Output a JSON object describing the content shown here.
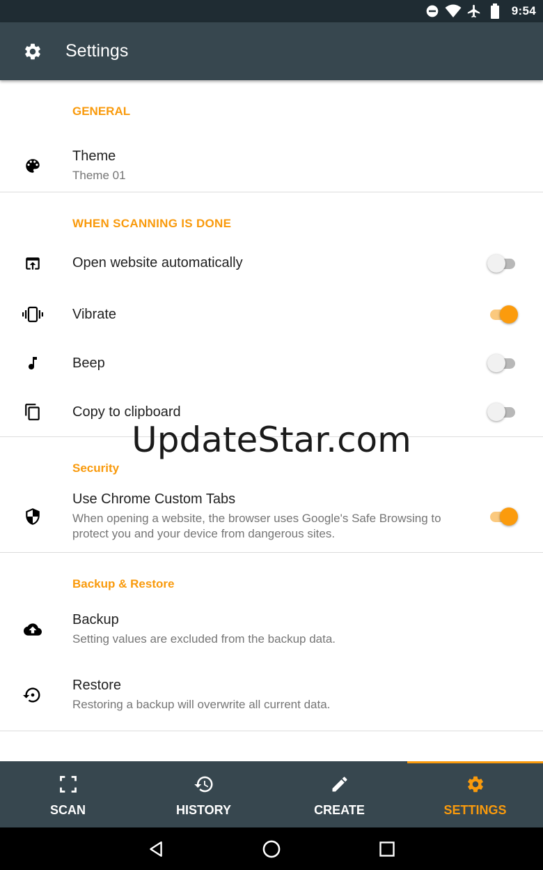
{
  "status_bar": {
    "time": "9:54",
    "icons": [
      "do-not-disturb-icon",
      "wifi-icon",
      "airplane-icon",
      "battery-icon"
    ]
  },
  "app_bar": {
    "title": "Settings",
    "icon": "gear-icon"
  },
  "sections": {
    "general": {
      "header": "GENERAL",
      "theme": {
        "title": "Theme",
        "subtitle": "Theme 01",
        "icon": "palette-icon"
      }
    },
    "scanning": {
      "header": "WHEN SCANNING IS DONE",
      "open_website": {
        "title": "Open website automatically",
        "enabled": false,
        "icon": "open-in-browser-icon"
      },
      "vibrate": {
        "title": "Vibrate",
        "enabled": true,
        "icon": "vibrate-icon"
      },
      "beep": {
        "title": "Beep",
        "enabled": false,
        "icon": "music-note-icon"
      },
      "copy_clipboard": {
        "title": "Copy to clipboard",
        "enabled": false,
        "icon": "copy-icon"
      }
    },
    "security": {
      "header": "Security",
      "chrome_tabs": {
        "title": "Use Chrome Custom Tabs",
        "subtitle": "When opening a website, the browser uses Google's Safe Browsing to protect you and your device from dangerous sites.",
        "enabled": true,
        "icon": "shield-icon"
      }
    },
    "backup": {
      "header": "Backup & Restore",
      "backup": {
        "title": "Backup",
        "subtitle": "Setting values are excluded from the backup data.",
        "icon": "cloud-upload-icon"
      },
      "restore": {
        "title": "Restore",
        "subtitle": "Restoring a backup will overwrite all current data.",
        "icon": "restore-icon"
      }
    }
  },
  "watermark": "UpdateStar.com",
  "bottom_nav": {
    "active": "settings",
    "items": [
      {
        "label": "SCAN",
        "icon": "scan-icon"
      },
      {
        "label": "HISTORY",
        "icon": "history-icon"
      },
      {
        "label": "CREATE",
        "icon": "pencil-icon"
      },
      {
        "label": "SETTINGS",
        "icon": "gear-icon"
      }
    ]
  },
  "colors": {
    "accent": "#f99a0c",
    "app_bar": "#37474f",
    "status_bar": "#1f2c33"
  }
}
